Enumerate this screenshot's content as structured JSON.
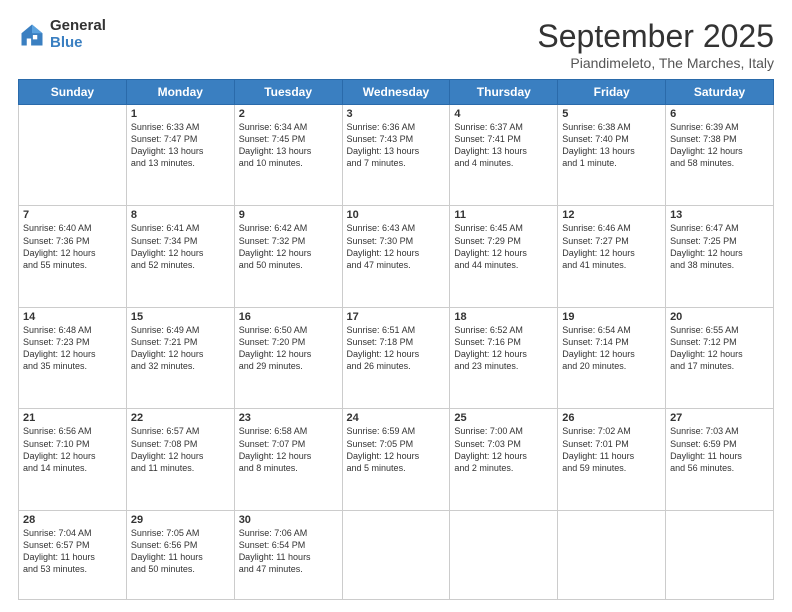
{
  "logo": {
    "general": "General",
    "blue": "Blue"
  },
  "header": {
    "month": "September 2025",
    "location": "Piandimeleto, The Marches, Italy"
  },
  "days": [
    "Sunday",
    "Monday",
    "Tuesday",
    "Wednesday",
    "Thursday",
    "Friday",
    "Saturday"
  ],
  "weeks": [
    [
      {
        "num": "",
        "info": ""
      },
      {
        "num": "1",
        "info": "Sunrise: 6:33 AM\nSunset: 7:47 PM\nDaylight: 13 hours\nand 13 minutes."
      },
      {
        "num": "2",
        "info": "Sunrise: 6:34 AM\nSunset: 7:45 PM\nDaylight: 13 hours\nand 10 minutes."
      },
      {
        "num": "3",
        "info": "Sunrise: 6:36 AM\nSunset: 7:43 PM\nDaylight: 13 hours\nand 7 minutes."
      },
      {
        "num": "4",
        "info": "Sunrise: 6:37 AM\nSunset: 7:41 PM\nDaylight: 13 hours\nand 4 minutes."
      },
      {
        "num": "5",
        "info": "Sunrise: 6:38 AM\nSunset: 7:40 PM\nDaylight: 13 hours\nand 1 minute."
      },
      {
        "num": "6",
        "info": "Sunrise: 6:39 AM\nSunset: 7:38 PM\nDaylight: 12 hours\nand 58 minutes."
      }
    ],
    [
      {
        "num": "7",
        "info": "Sunrise: 6:40 AM\nSunset: 7:36 PM\nDaylight: 12 hours\nand 55 minutes."
      },
      {
        "num": "8",
        "info": "Sunrise: 6:41 AM\nSunset: 7:34 PM\nDaylight: 12 hours\nand 52 minutes."
      },
      {
        "num": "9",
        "info": "Sunrise: 6:42 AM\nSunset: 7:32 PM\nDaylight: 12 hours\nand 50 minutes."
      },
      {
        "num": "10",
        "info": "Sunrise: 6:43 AM\nSunset: 7:30 PM\nDaylight: 12 hours\nand 47 minutes."
      },
      {
        "num": "11",
        "info": "Sunrise: 6:45 AM\nSunset: 7:29 PM\nDaylight: 12 hours\nand 44 minutes."
      },
      {
        "num": "12",
        "info": "Sunrise: 6:46 AM\nSunset: 7:27 PM\nDaylight: 12 hours\nand 41 minutes."
      },
      {
        "num": "13",
        "info": "Sunrise: 6:47 AM\nSunset: 7:25 PM\nDaylight: 12 hours\nand 38 minutes."
      }
    ],
    [
      {
        "num": "14",
        "info": "Sunrise: 6:48 AM\nSunset: 7:23 PM\nDaylight: 12 hours\nand 35 minutes."
      },
      {
        "num": "15",
        "info": "Sunrise: 6:49 AM\nSunset: 7:21 PM\nDaylight: 12 hours\nand 32 minutes."
      },
      {
        "num": "16",
        "info": "Sunrise: 6:50 AM\nSunset: 7:20 PM\nDaylight: 12 hours\nand 29 minutes."
      },
      {
        "num": "17",
        "info": "Sunrise: 6:51 AM\nSunset: 7:18 PM\nDaylight: 12 hours\nand 26 minutes."
      },
      {
        "num": "18",
        "info": "Sunrise: 6:52 AM\nSunset: 7:16 PM\nDaylight: 12 hours\nand 23 minutes."
      },
      {
        "num": "19",
        "info": "Sunrise: 6:54 AM\nSunset: 7:14 PM\nDaylight: 12 hours\nand 20 minutes."
      },
      {
        "num": "20",
        "info": "Sunrise: 6:55 AM\nSunset: 7:12 PM\nDaylight: 12 hours\nand 17 minutes."
      }
    ],
    [
      {
        "num": "21",
        "info": "Sunrise: 6:56 AM\nSunset: 7:10 PM\nDaylight: 12 hours\nand 14 minutes."
      },
      {
        "num": "22",
        "info": "Sunrise: 6:57 AM\nSunset: 7:08 PM\nDaylight: 12 hours\nand 11 minutes."
      },
      {
        "num": "23",
        "info": "Sunrise: 6:58 AM\nSunset: 7:07 PM\nDaylight: 12 hours\nand 8 minutes."
      },
      {
        "num": "24",
        "info": "Sunrise: 6:59 AM\nSunset: 7:05 PM\nDaylight: 12 hours\nand 5 minutes."
      },
      {
        "num": "25",
        "info": "Sunrise: 7:00 AM\nSunset: 7:03 PM\nDaylight: 12 hours\nand 2 minutes."
      },
      {
        "num": "26",
        "info": "Sunrise: 7:02 AM\nSunset: 7:01 PM\nDaylight: 11 hours\nand 59 minutes."
      },
      {
        "num": "27",
        "info": "Sunrise: 7:03 AM\nSunset: 6:59 PM\nDaylight: 11 hours\nand 56 minutes."
      }
    ],
    [
      {
        "num": "28",
        "info": "Sunrise: 7:04 AM\nSunset: 6:57 PM\nDaylight: 11 hours\nand 53 minutes."
      },
      {
        "num": "29",
        "info": "Sunrise: 7:05 AM\nSunset: 6:56 PM\nDaylight: 11 hours\nand 50 minutes."
      },
      {
        "num": "30",
        "info": "Sunrise: 7:06 AM\nSunset: 6:54 PM\nDaylight: 11 hours\nand 47 minutes."
      },
      {
        "num": "",
        "info": ""
      },
      {
        "num": "",
        "info": ""
      },
      {
        "num": "",
        "info": ""
      },
      {
        "num": "",
        "info": ""
      }
    ]
  ]
}
